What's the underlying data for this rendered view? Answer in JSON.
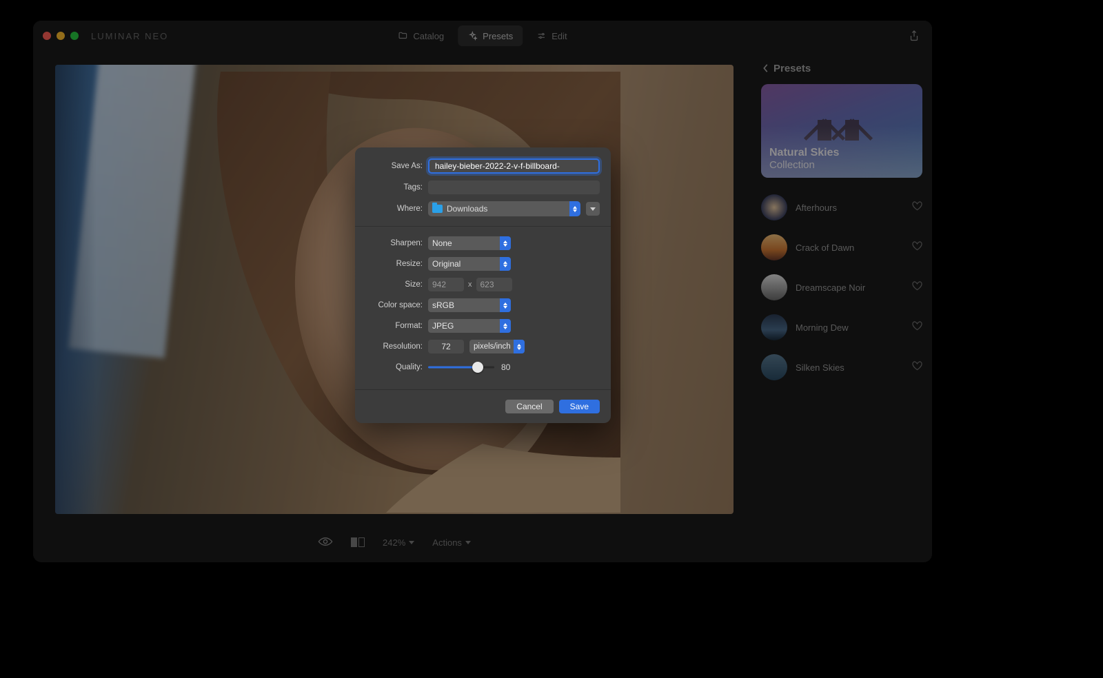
{
  "app": {
    "name": "LUMINAR NEO",
    "tabs": {
      "catalog": "Catalog",
      "presets": "Presets",
      "edit": "Edit"
    }
  },
  "bottom_toolbar": {
    "zoom": "242%",
    "actions": "Actions"
  },
  "side_panel": {
    "title": "Presets",
    "collection": {
      "line1": "Natural Skies",
      "line2": "Collection"
    },
    "presets": [
      {
        "name": "Afterhours"
      },
      {
        "name": "Crack of Dawn"
      },
      {
        "name": "Dreamscape Noir"
      },
      {
        "name": "Morning Dew"
      },
      {
        "name": "Silken Skies"
      }
    ]
  },
  "export_dialog": {
    "labels": {
      "save_as": "Save As:",
      "tags": "Tags:",
      "where": "Where:",
      "sharpen": "Sharpen:",
      "resize": "Resize:",
      "size": "Size:",
      "color_space": "Color space:",
      "format": "Format:",
      "resolution": "Resolution:",
      "quality": "Quality:"
    },
    "save_as_value": "hailey-bieber-2022-2-v-f-billboard-",
    "where_value": "Downloads",
    "sharpen_value": "None",
    "resize_value": "Original",
    "size_w": "942",
    "size_x": "x",
    "size_h": "623",
    "color_space_value": "sRGB",
    "format_value": "JPEG",
    "resolution_value": "72",
    "resolution_unit": "pixels/inch",
    "quality_value": "80",
    "quality_percent": 80,
    "buttons": {
      "cancel": "Cancel",
      "save": "Save"
    }
  }
}
